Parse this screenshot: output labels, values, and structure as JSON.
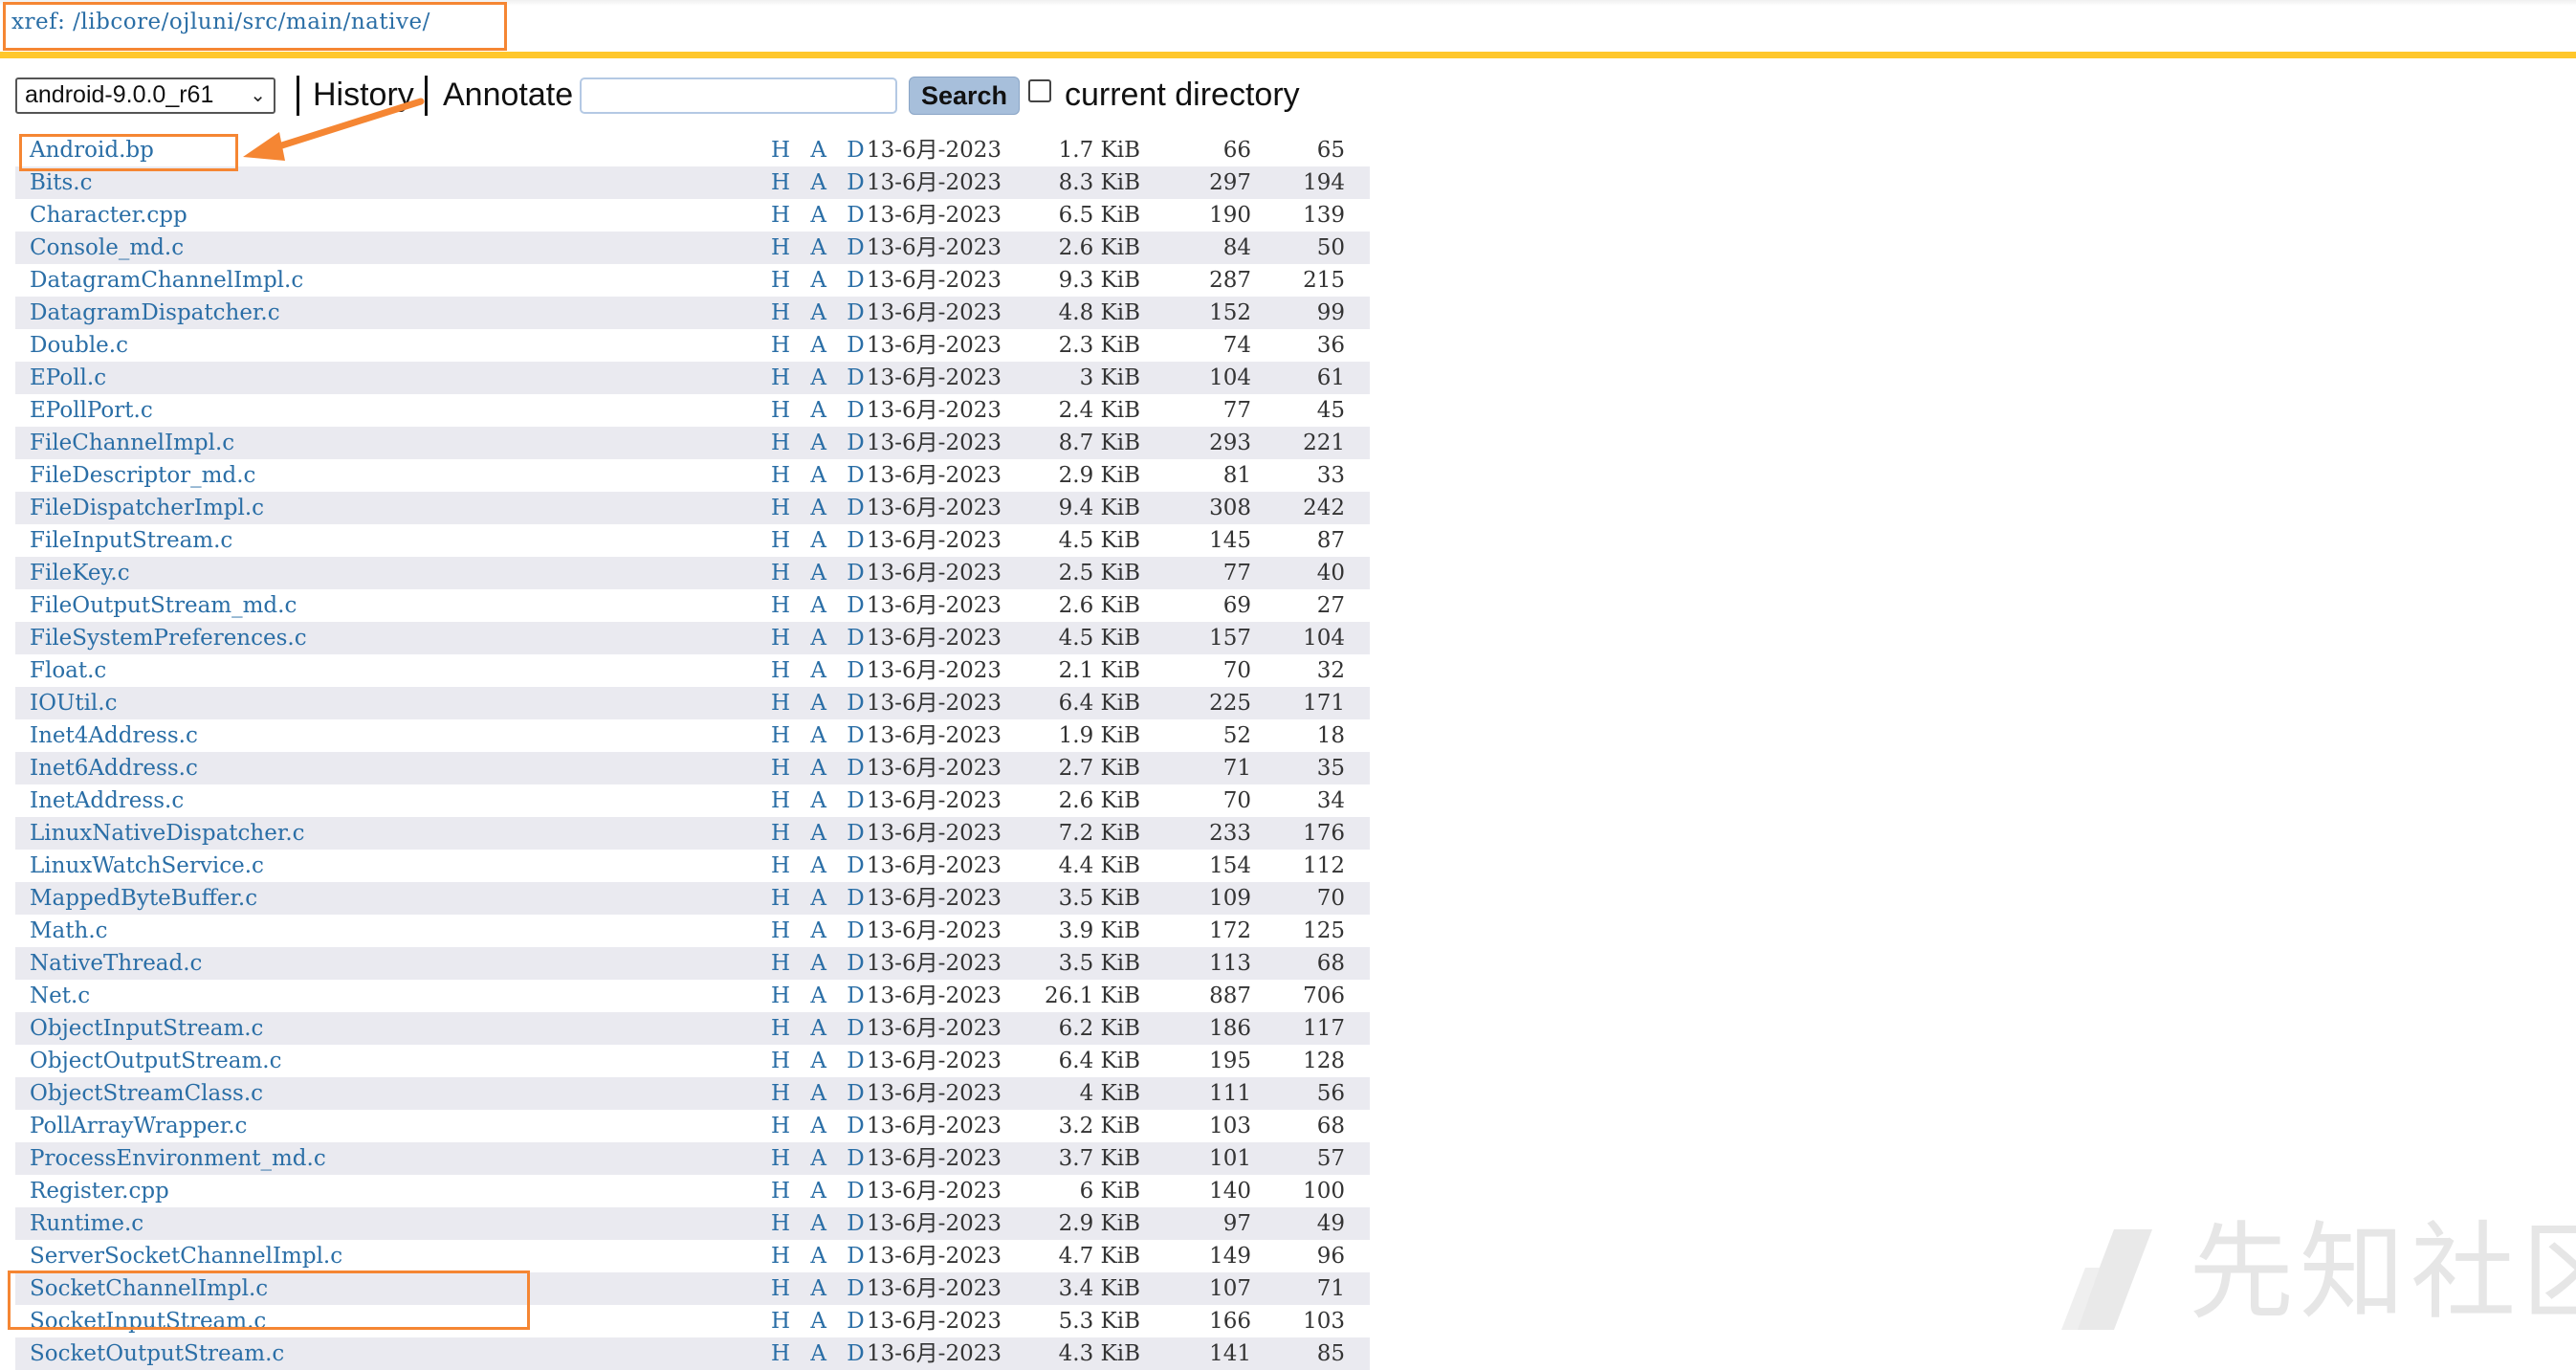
{
  "header": {
    "xref_path": "xref: /libcore/ojluni/src/main/native/"
  },
  "toolbar": {
    "version": "android-9.0.0_r61",
    "history": "History",
    "annotate": "Annotate",
    "search_value": "",
    "search_button": "Search",
    "current_directory": "current directory",
    "current_directory_checked": false
  },
  "file_rows": [
    {
      "name": "Android.bp",
      "had": "H A D",
      "date": "13-6月-2023",
      "size": "1.7 KiB",
      "lines": "66",
      "loc": "65"
    },
    {
      "name": "Bits.c",
      "had": "H A D",
      "date": "13-6月-2023",
      "size": "8.3 KiB",
      "lines": "297",
      "loc": "194"
    },
    {
      "name": "Character.cpp",
      "had": "H A D",
      "date": "13-6月-2023",
      "size": "6.5 KiB",
      "lines": "190",
      "loc": "139"
    },
    {
      "name": "Console_md.c",
      "had": "H A D",
      "date": "13-6月-2023",
      "size": "2.6 KiB",
      "lines": "84",
      "loc": "50"
    },
    {
      "name": "DatagramChannelImpl.c",
      "had": "H A D",
      "date": "13-6月-2023",
      "size": "9.3 KiB",
      "lines": "287",
      "loc": "215"
    },
    {
      "name": "DatagramDispatcher.c",
      "had": "H A D",
      "date": "13-6月-2023",
      "size": "4.8 KiB",
      "lines": "152",
      "loc": "99"
    },
    {
      "name": "Double.c",
      "had": "H A D",
      "date": "13-6月-2023",
      "size": "2.3 KiB",
      "lines": "74",
      "loc": "36"
    },
    {
      "name": "EPoll.c",
      "had": "H A D",
      "date": "13-6月-2023",
      "size": "3 KiB",
      "lines": "104",
      "loc": "61"
    },
    {
      "name": "EPollPort.c",
      "had": "H A D",
      "date": "13-6月-2023",
      "size": "2.4 KiB",
      "lines": "77",
      "loc": "45"
    },
    {
      "name": "FileChannelImpl.c",
      "had": "H A D",
      "date": "13-6月-2023",
      "size": "8.7 KiB",
      "lines": "293",
      "loc": "221"
    },
    {
      "name": "FileDescriptor_md.c",
      "had": "H A D",
      "date": "13-6月-2023",
      "size": "2.9 KiB",
      "lines": "81",
      "loc": "33"
    },
    {
      "name": "FileDispatcherImpl.c",
      "had": "H A D",
      "date": "13-6月-2023",
      "size": "9.4 KiB",
      "lines": "308",
      "loc": "242"
    },
    {
      "name": "FileInputStream.c",
      "had": "H A D",
      "date": "13-6月-2023",
      "size": "4.5 KiB",
      "lines": "145",
      "loc": "87"
    },
    {
      "name": "FileKey.c",
      "had": "H A D",
      "date": "13-6月-2023",
      "size": "2.5 KiB",
      "lines": "77",
      "loc": "40"
    },
    {
      "name": "FileOutputStream_md.c",
      "had": "H A D",
      "date": "13-6月-2023",
      "size": "2.6 KiB",
      "lines": "69",
      "loc": "27"
    },
    {
      "name": "FileSystemPreferences.c",
      "had": "H A D",
      "date": "13-6月-2023",
      "size": "4.5 KiB",
      "lines": "157",
      "loc": "104"
    },
    {
      "name": "Float.c",
      "had": "H A D",
      "date": "13-6月-2023",
      "size": "2.1 KiB",
      "lines": "70",
      "loc": "32"
    },
    {
      "name": "IOUtil.c",
      "had": "H A D",
      "date": "13-6月-2023",
      "size": "6.4 KiB",
      "lines": "225",
      "loc": "171"
    },
    {
      "name": "Inet4Address.c",
      "had": "H A D",
      "date": "13-6月-2023",
      "size": "1.9 KiB",
      "lines": "52",
      "loc": "18"
    },
    {
      "name": "Inet6Address.c",
      "had": "H A D",
      "date": "13-6月-2023",
      "size": "2.7 KiB",
      "lines": "71",
      "loc": "35"
    },
    {
      "name": "InetAddress.c",
      "had": "H A D",
      "date": "13-6月-2023",
      "size": "2.6 KiB",
      "lines": "70",
      "loc": "34"
    },
    {
      "name": "LinuxNativeDispatcher.c",
      "had": "H A D",
      "date": "13-6月-2023",
      "size": "7.2 KiB",
      "lines": "233",
      "loc": "176"
    },
    {
      "name": "LinuxWatchService.c",
      "had": "H A D",
      "date": "13-6月-2023",
      "size": "4.4 KiB",
      "lines": "154",
      "loc": "112"
    },
    {
      "name": "MappedByteBuffer.c",
      "had": "H A D",
      "date": "13-6月-2023",
      "size": "3.5 KiB",
      "lines": "109",
      "loc": "70"
    },
    {
      "name": "Math.c",
      "had": "H A D",
      "date": "13-6月-2023",
      "size": "3.9 KiB",
      "lines": "172",
      "loc": "125"
    },
    {
      "name": "NativeThread.c",
      "had": "H A D",
      "date": "13-6月-2023",
      "size": "3.5 KiB",
      "lines": "113",
      "loc": "68"
    },
    {
      "name": "Net.c",
      "had": "H A D",
      "date": "13-6月-2023",
      "size": "26.1 KiB",
      "lines": "887",
      "loc": "706"
    },
    {
      "name": "ObjectInputStream.c",
      "had": "H A D",
      "date": "13-6月-2023",
      "size": "6.2 KiB",
      "lines": "186",
      "loc": "117"
    },
    {
      "name": "ObjectOutputStream.c",
      "had": "H A D",
      "date": "13-6月-2023",
      "size": "6.4 KiB",
      "lines": "195",
      "loc": "128"
    },
    {
      "name": "ObjectStreamClass.c",
      "had": "H A D",
      "date": "13-6月-2023",
      "size": "4 KiB",
      "lines": "111",
      "loc": "56"
    },
    {
      "name": "PollArrayWrapper.c",
      "had": "H A D",
      "date": "13-6月-2023",
      "size": "3.2 KiB",
      "lines": "103",
      "loc": "68"
    },
    {
      "name": "ProcessEnvironment_md.c",
      "had": "H A D",
      "date": "13-6月-2023",
      "size": "3.7 KiB",
      "lines": "101",
      "loc": "57"
    },
    {
      "name": "Register.cpp",
      "had": "H A D",
      "date": "13-6月-2023",
      "size": "6 KiB",
      "lines": "140",
      "loc": "100"
    },
    {
      "name": "Runtime.c",
      "had": "H A D",
      "date": "13-6月-2023",
      "size": "2.9 KiB",
      "lines": "97",
      "loc": "49"
    },
    {
      "name": "ServerSocketChannelImpl.c",
      "had": "H A D",
      "date": "13-6月-2023",
      "size": "4.7 KiB",
      "lines": "149",
      "loc": "96"
    },
    {
      "name": "SocketChannelImpl.c",
      "had": "H A D",
      "date": "13-6月-2023",
      "size": "3.4 KiB",
      "lines": "107",
      "loc": "71"
    },
    {
      "name": "SocketInputStream.c",
      "had": "H A D",
      "date": "13-6月-2023",
      "size": "5.3 KiB",
      "lines": "166",
      "loc": "103"
    },
    {
      "name": "SocketOutputStream.c",
      "had": "H A D",
      "date": "13-6月-2023",
      "size": "4.3 KiB",
      "lines": "141",
      "loc": "85"
    }
  ],
  "colors": {
    "link": "#2a6ea6",
    "header_border": "#ffc72c",
    "highlight": "#f58633",
    "row_alt": "#eaeaf0",
    "search_button": "#a7bfdb"
  },
  "watermark": {
    "icon": "xianzhi-logo-icon",
    "text": "先知社区"
  }
}
